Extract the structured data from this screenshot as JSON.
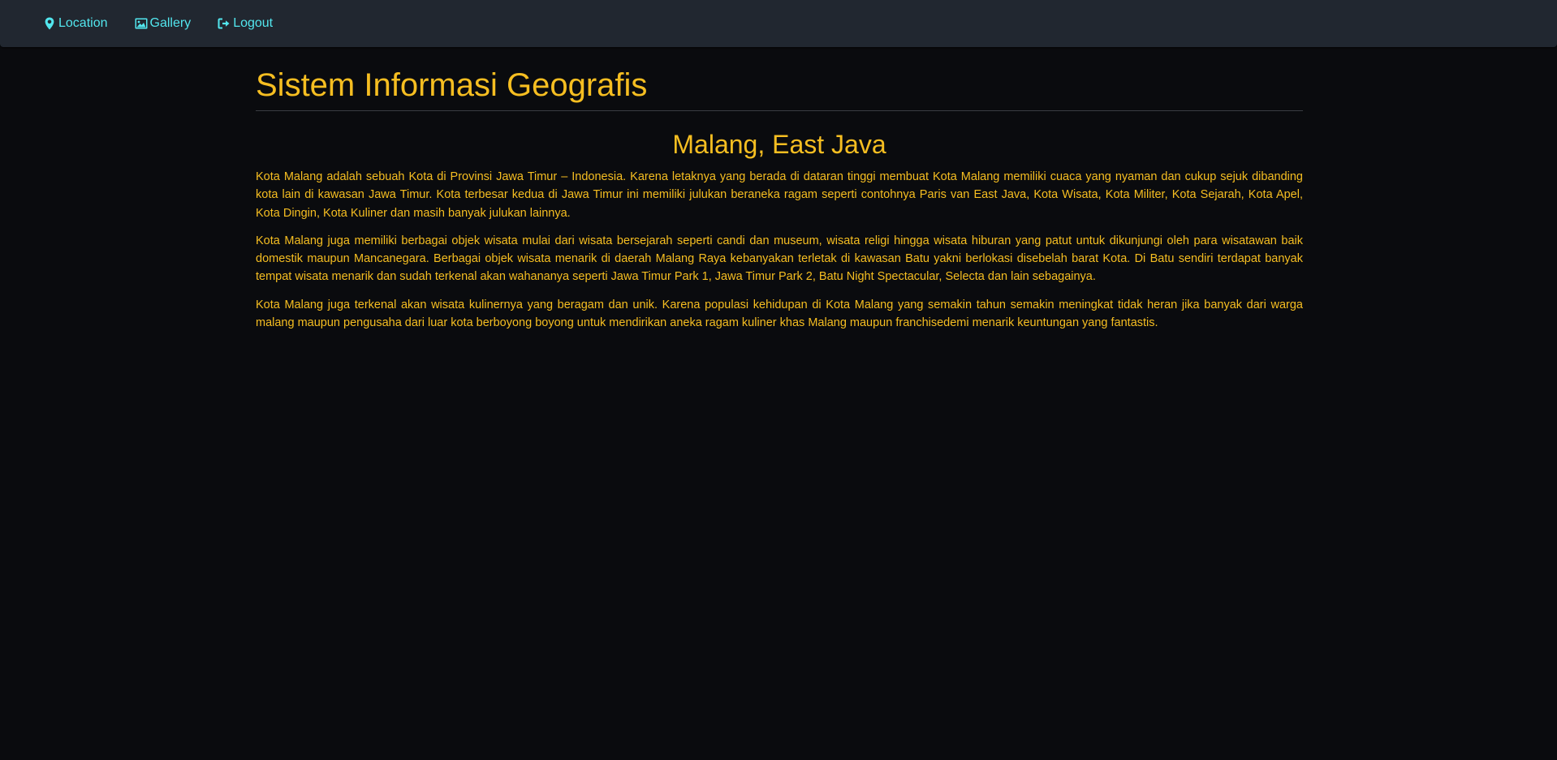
{
  "nav": {
    "items": [
      {
        "label": "Location",
        "icon": "map-marker-icon"
      },
      {
        "label": "Gallery",
        "icon": "image-icon"
      },
      {
        "label": "Logout",
        "icon": "sign-out-icon"
      }
    ]
  },
  "header": {
    "title": "Sistem Informasi Geografis"
  },
  "content": {
    "heading": "Malang, East Java",
    "paragraphs": [
      "Kota Malang adalah sebuah Kota di Provinsi Jawa Timur – Indonesia. Karena letaknya yang berada di dataran tinggi membuat Kota Malang memiliki cuaca yang nyaman dan cukup sejuk dibanding kota lain di kawasan Jawa Timur. Kota terbesar kedua di Jawa Timur ini memiliki julukan beraneka ragam seperti contohnya Paris van East Java, Kota Wisata, Kota Militer, Kota Sejarah, Kota Apel, Kota Dingin, Kota Kuliner dan masih banyak julukan lainnya.",
      "Kota Malang juga memiliki berbagai objek wisata mulai dari wisata bersejarah seperti candi dan museum, wisata religi hingga wisata hiburan yang patut untuk dikunjungi oleh para wisatawan baik domestik maupun Mancanegara. Berbagai objek wisata menarik di daerah Malang Raya kebanyakan terletak di kawasan Batu yakni berlokasi disebelah barat Kota. Di Batu sendiri terdapat banyak tempat wisata menarik dan sudah terkenal akan wahananya seperti Jawa Timur Park 1, Jawa Timur Park 2, Batu Night Spectacular, Selecta dan lain sebagainya.",
      "Kota Malang juga terkenal akan wisata kulinernya yang beragam dan unik. Karena populasi kehidupan di Kota Malang yang semakin tahun semakin meningkat tidak heran jika banyak dari warga malang maupun pengusaha dari luar kota berboyong boyong untuk mendirikan aneka ragam kuliner khas Malang maupun franchisedemi menarik keuntungan yang fantastis."
    ]
  },
  "colors": {
    "background": "#0a0b0e",
    "navbar": "#212730",
    "nav_link": "#52e6ee",
    "text_accent": "#f6be21",
    "divider": "#3a3d42"
  }
}
